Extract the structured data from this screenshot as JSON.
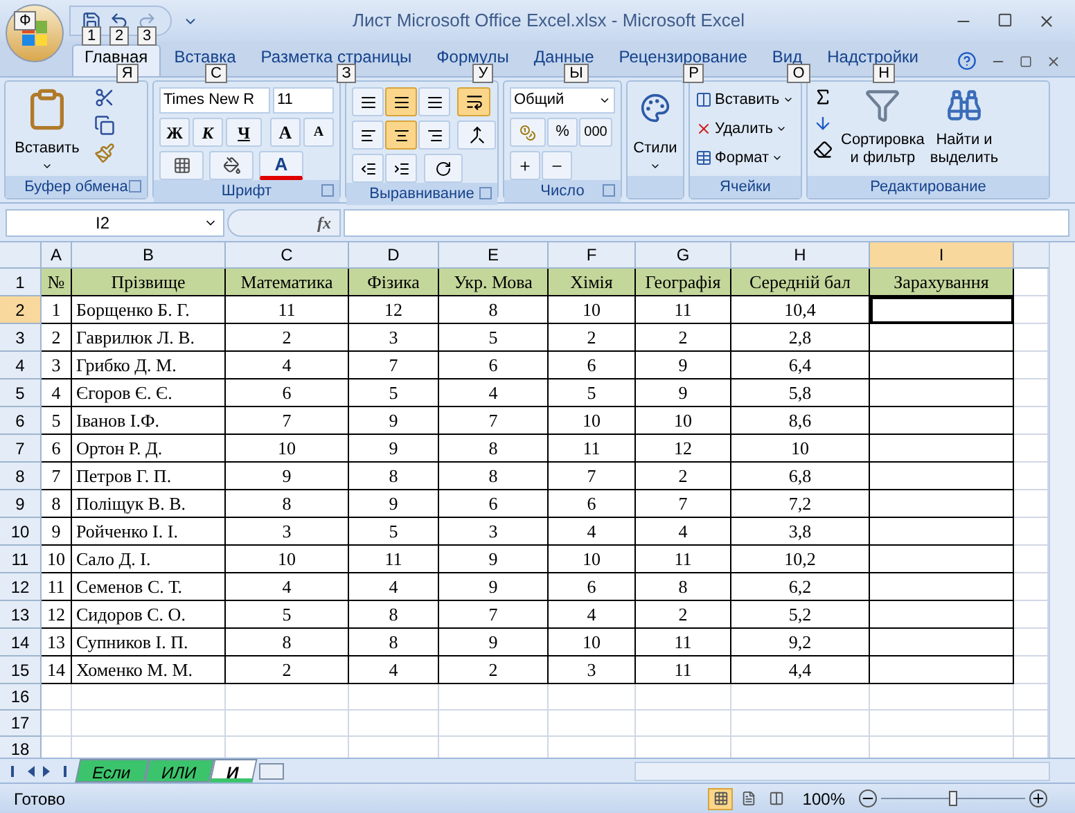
{
  "window": {
    "title": "Лист Microsoft Office Excel.xlsx - Microsoft Excel"
  },
  "office_button": {
    "keytip": "Ф"
  },
  "quick_access": [
    {
      "kind": "save",
      "keytip": "1",
      "disabled": false
    },
    {
      "kind": "undo",
      "keytip": "2",
      "disabled": false
    },
    {
      "kind": "redo",
      "keytip": "3",
      "disabled": true
    }
  ],
  "tabs": [
    {
      "label": "Главная",
      "keytip": "Я",
      "selected": true
    },
    {
      "label": "Вставка",
      "keytip": "С",
      "selected": false
    },
    {
      "label": "Разметка страницы",
      "keytip": "З",
      "selected": false
    },
    {
      "label": "Формулы",
      "keytip": "У",
      "selected": false
    },
    {
      "label": "Данные",
      "keytip": "Ы",
      "selected": false
    },
    {
      "label": "Рецензирование",
      "keytip": "Р",
      "selected": false
    },
    {
      "label": "Вид",
      "keytip": "О",
      "selected": false
    },
    {
      "label": "Надстройки",
      "keytip": "Н",
      "selected": false
    }
  ],
  "ribbon": {
    "clipboard": {
      "paste": "Вставить",
      "label": "Буфер обмена"
    },
    "font": {
      "name": "Times New R",
      "size": "11",
      "bold": "Ж",
      "italic": "К",
      "underline": "Ч",
      "grow": "A",
      "shrink": "A",
      "color_letter": "A",
      "label": "Шрифт"
    },
    "alignment": {
      "vertical": [
        {
          "selected": false
        },
        {
          "selected": true
        },
        {
          "selected": false
        }
      ],
      "horizontal": [
        {
          "selected": false
        },
        {
          "selected": true
        },
        {
          "selected": false
        }
      ],
      "wrap": {
        "selected": true
      },
      "label": "Выравнивание"
    },
    "number": {
      "format": "Общий",
      "percent": "%",
      "thousands": "000",
      "label": "Число"
    },
    "styles": {
      "button": "Стили"
    },
    "cells": {
      "items": [
        "Вставить",
        "Удалить",
        "Формат"
      ],
      "label": "Ячейки"
    },
    "editing": {
      "sort": "Сортировка",
      "sort_2": "и фильтр",
      "find": "Найти и",
      "find_2": "выделить",
      "label": "Редактирование"
    }
  },
  "formula_bar": {
    "name_box": "I2",
    "function_label": "fx"
  },
  "sheet": {
    "columns": [
      {
        "label": "A",
        "selected": false
      },
      {
        "label": "B",
        "selected": false
      },
      {
        "label": "C",
        "selected": false
      },
      {
        "label": "D",
        "selected": false
      },
      {
        "label": "E",
        "selected": false
      },
      {
        "label": "F",
        "selected": false
      },
      {
        "label": "G",
        "selected": false
      },
      {
        "label": "H",
        "selected": false
      },
      {
        "label": "I",
        "selected": true
      }
    ],
    "rows": [
      {
        "number": "1",
        "selected": false,
        "kind": "header",
        "cells": [
          "№",
          "Прізвище",
          "Математика",
          "Фізика",
          "Укр. Мова",
          "Хімія",
          "Географія",
          "Середній бал",
          "Зарахування"
        ]
      },
      {
        "number": "2",
        "selected": true,
        "kind": "data",
        "cells": [
          "1",
          "Борщенко Б. Г.",
          "11",
          "12",
          "8",
          "10",
          "11",
          "10,4"
        ]
      },
      {
        "number": "3",
        "selected": false,
        "kind": "data",
        "cells": [
          "2",
          "Гаврилюк Л. В.",
          "2",
          "3",
          "5",
          "2",
          "2",
          "2,8"
        ]
      },
      {
        "number": "4",
        "selected": false,
        "kind": "data",
        "cells": [
          "3",
          "Грибко Д. М.",
          "4",
          "7",
          "6",
          "6",
          "9",
          "6,4"
        ]
      },
      {
        "number": "5",
        "selected": false,
        "kind": "data",
        "cells": [
          "4",
          "Єгоров Є. Є.",
          "6",
          "5",
          "4",
          "5",
          "9",
          "5,8"
        ]
      },
      {
        "number": "6",
        "selected": false,
        "kind": "data",
        "cells": [
          "5",
          "Іванов І.Ф.",
          "7",
          "9",
          "7",
          "10",
          "10",
          "8,6"
        ]
      },
      {
        "number": "7",
        "selected": false,
        "kind": "data",
        "cells": [
          "6",
          "Ортон Р. Д.",
          "10",
          "9",
          "8",
          "11",
          "12",
          "10"
        ]
      },
      {
        "number": "8",
        "selected": false,
        "kind": "data",
        "cells": [
          "7",
          "Петров Г. П.",
          "9",
          "8",
          "8",
          "7",
          "2",
          "6,8"
        ]
      },
      {
        "number": "9",
        "selected": false,
        "kind": "data",
        "cells": [
          "8",
          "Поліщук В. В.",
          "8",
          "9",
          "6",
          "6",
          "7",
          "7,2"
        ]
      },
      {
        "number": "10",
        "selected": false,
        "kind": "data",
        "cells": [
          "9",
          "Ройченко І. І.",
          "3",
          "5",
          "3",
          "4",
          "4",
          "3,8"
        ]
      },
      {
        "number": "11",
        "selected": false,
        "kind": "data",
        "cells": [
          "10",
          "Сало Д. І.",
          "10",
          "11",
          "9",
          "10",
          "11",
          "10,2"
        ]
      },
      {
        "number": "12",
        "selected": false,
        "kind": "data",
        "cells": [
          "11",
          "Семенов С. Т.",
          "4",
          "4",
          "9",
          "6",
          "8",
          "6,2"
        ]
      },
      {
        "number": "13",
        "selected": false,
        "kind": "data",
        "cells": [
          "12",
          "Сидоров С. О.",
          "5",
          "8",
          "7",
          "4",
          "2",
          "5,2"
        ]
      },
      {
        "number": "14",
        "selected": false,
        "kind": "data",
        "cells": [
          "13",
          "Супников І. П.",
          "8",
          "8",
          "9",
          "10",
          "11",
          "9,2"
        ]
      },
      {
        "number": "15",
        "selected": false,
        "kind": "data",
        "cells": [
          "14",
          "Хоменко М. М.",
          "2",
          "4",
          "2",
          "3",
          "11",
          "4,4"
        ]
      },
      {
        "number": "16",
        "selected": false,
        "kind": "empty"
      },
      {
        "number": "17",
        "selected": false,
        "kind": "empty"
      },
      {
        "number": "18",
        "selected": false,
        "kind": "empty"
      }
    ]
  },
  "sheet_tabs": [
    {
      "label": "Если",
      "selected": false,
      "color": "#3cc46c"
    },
    {
      "label": "ИЛИ",
      "selected": false,
      "color": "#3cc46c"
    },
    {
      "label": "И",
      "selected": true,
      "color": "#3cc46c"
    }
  ],
  "status_bar": {
    "text": "Готово",
    "views": [
      {
        "selected": true
      },
      {
        "selected": false
      },
      {
        "selected": false
      }
    ],
    "zoom": "100%",
    "zoom_slider": {
      "level": 0.5
    }
  }
}
